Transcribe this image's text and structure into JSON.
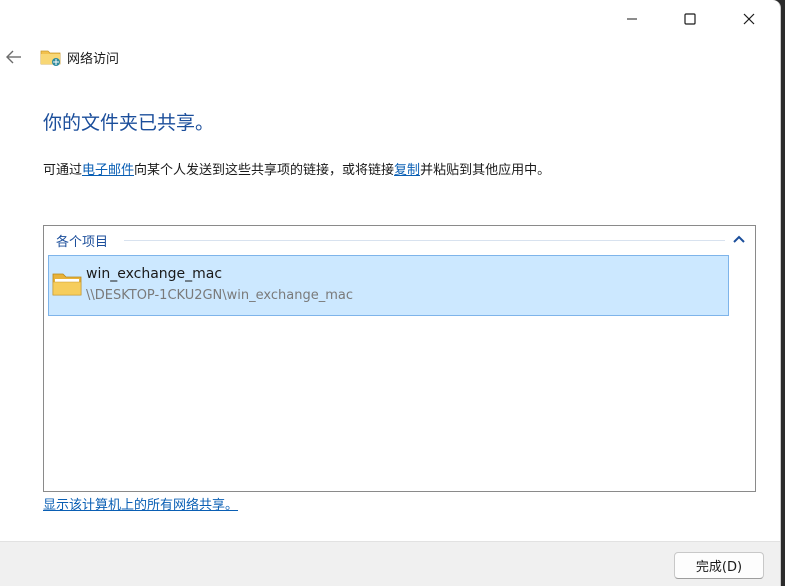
{
  "window": {
    "title": "网络访问",
    "minimize_icon": "minimize-icon",
    "maximize_icon": "maximize-icon",
    "close_icon": "close-icon",
    "back_icon": "back-arrow-icon"
  },
  "main": {
    "heading": "你的文件夹已共享。",
    "instructions_part1": "可通过",
    "email_link": "电子邮件",
    "instructions_part2": "向某个人发送到这些共享项的链接，或将链接",
    "copy_link": "复制",
    "instructions_part3": "并粘贴到其他应用中。"
  },
  "items": {
    "group_header": "各个项目",
    "list": [
      {
        "name": "win_exchange_mac",
        "path": "\\\\DESKTOP-1CKU2GN\\win_exchange_mac",
        "icon": "folder-icon"
      }
    ]
  },
  "bottom_link": "显示该计算机上的所有网络共享。",
  "footer": {
    "done_label": "完成(D)"
  },
  "colors": {
    "heading": "#1b4e9b",
    "link": "#0a5fb4",
    "selection_bg": "#cce8ff",
    "selection_border": "#7eb4ea"
  }
}
